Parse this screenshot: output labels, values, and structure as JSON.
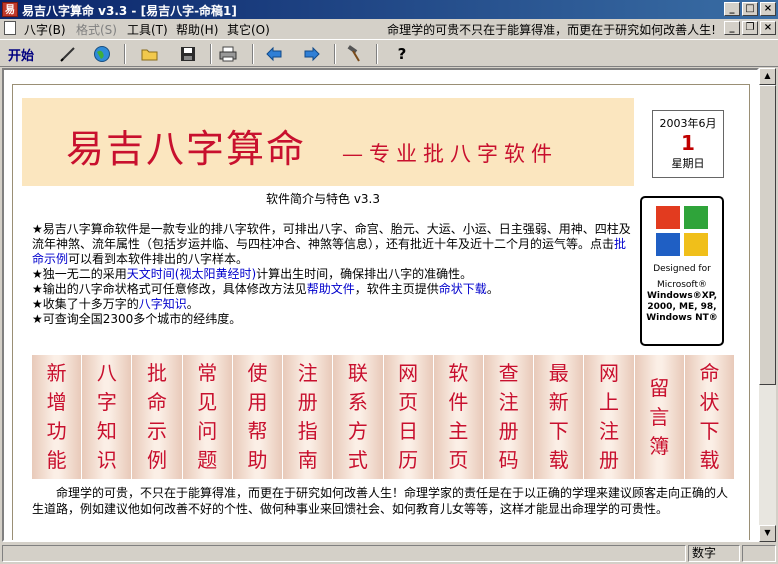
{
  "window": {
    "icon_text": "易",
    "title": "易吉八字算命 v3.3 - [易吉八字-命稿1]",
    "buttons": [
      "_",
      "□",
      "×"
    ]
  },
  "menubar": {
    "items": [
      "八字(B)",
      "格式(S)",
      "工具(T)",
      "帮助(H)",
      "其它(O)"
    ],
    "motto": "命理学的可贵不只在于能算得准，而更在于研究如何改善人生!",
    "mdi_buttons": [
      "_",
      "❐",
      "×"
    ]
  },
  "toolbar": {
    "start_label": "开始",
    "icons": [
      "pen-icon",
      "globe-icon",
      "open-folder-icon",
      "save-icon",
      "print-icon",
      "back-arrow-icon",
      "forward-arrow-icon",
      "hammer-icon",
      "help-icon"
    ]
  },
  "banner": {
    "title": "易吉八字算命",
    "subtitle": "—专业批八字软件"
  },
  "calendar": {
    "month": "2003年6月",
    "day": "1",
    "weekday": "星期日"
  },
  "windows_logo": {
    "designed_for": "Designed for",
    "microsoft": "Microsoft®",
    "line1": "Windows®XP,",
    "line2": "2000, ME, 98,",
    "line3": "Windows NT®"
  },
  "intro": {
    "title": "软件简介与特色 v3.3",
    "p1": "★易吉八字算命软件是一款专业的排八字软件，可排出八字、命宫、胎元、大运、小运、日主强弱、用神、四柱及流年神煞、流年属性（包括岁运并临、与四柱冲合、神煞等信息），还有批近十年及近十二个月的运气等。点击",
    "p1_link": "批命示例",
    "p1_end": "可以看到本软件排出的八字样本。",
    "p2": "★独一无二的采用",
    "p2_link": "天文时间(视太阳黄经时)",
    "p2_end": "计算出生时间，确保排出八字的准确性。",
    "p3": "★输出的八字命状格式可任意修改，具体修改方法见",
    "p3_link1": "帮助文件",
    "p3_mid": "，软件主页提供",
    "p3_link2": "命状下载",
    "p3_end": "。",
    "p4": "★收集了十多万字的",
    "p4_link": "八字知识",
    "p4_end": "。",
    "p5": "★可查询全国2300多个城市的经纬度。"
  },
  "cards": [
    [
      "新",
      "增",
      "功",
      "能"
    ],
    [
      "八",
      "字",
      "知",
      "识"
    ],
    [
      "批",
      "命",
      "示",
      "例"
    ],
    [
      "常",
      "见",
      "问",
      "题"
    ],
    [
      "使",
      "用",
      "帮",
      "助"
    ],
    [
      "注",
      "册",
      "指",
      "南"
    ],
    [
      "联",
      "系",
      "方",
      "式"
    ],
    [
      "网",
      "页",
      "日",
      "历"
    ],
    [
      "软",
      "件",
      "主",
      "页"
    ],
    [
      "查",
      "注",
      "册",
      "码"
    ],
    [
      "最",
      "新",
      "下",
      "载"
    ],
    [
      "网",
      "上",
      "注",
      "册"
    ],
    [
      "留",
      "言",
      "簿"
    ],
    [
      "命",
      "状",
      "下",
      "载"
    ]
  ],
  "motto": "命理学的可贵，不只在于能算得准，而更在于研究如何改善人生！命理学家的责任是在于以正确的学理来建议顾客走向正确的人生道路，例如建议他如何改善不好的个性、做何种事业来回馈社会、如何教育儿女等等，这样才能显出命理学的可贵性。",
  "status": {
    "num_label": "数字"
  }
}
